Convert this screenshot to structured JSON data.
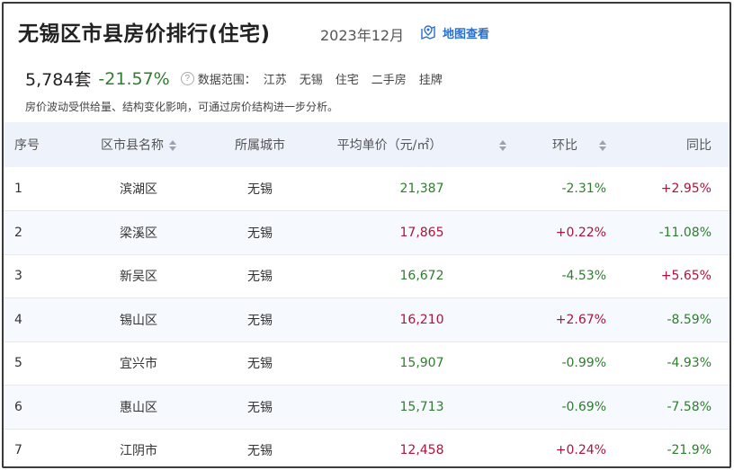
{
  "header": {
    "title": "无锡区市县房价排行(住宅)",
    "date": "2023年12月",
    "map_link": "地图查看",
    "count": "5,784套",
    "change": "-21.57%",
    "scope_label": "数据范围：",
    "scope": [
      "江苏",
      "无锡",
      "住宅",
      "二手房",
      "挂牌"
    ],
    "note": "房价波动受供给量、结构变化影响，可通过房价结构进一步分析。"
  },
  "table": {
    "columns": [
      "序号",
      "区市县名称",
      "所属城市",
      "平均单价（元/㎡）",
      "环比",
      "同比"
    ],
    "rows": [
      {
        "idx": "1",
        "district": "滨湖区",
        "city": "无锡",
        "price": "21,387",
        "price_trend": "down",
        "mom": "-2.31%",
        "yoy": "+2.95%"
      },
      {
        "idx": "2",
        "district": "梁溪区",
        "city": "无锡",
        "price": "17,865",
        "price_trend": "up",
        "mom": "+0.22%",
        "yoy": "-11.08%"
      },
      {
        "idx": "3",
        "district": "新吴区",
        "city": "无锡",
        "price": "16,672",
        "price_trend": "down",
        "mom": "-4.53%",
        "yoy": "+5.65%"
      },
      {
        "idx": "4",
        "district": "锡山区",
        "city": "无锡",
        "price": "16,210",
        "price_trend": "up",
        "mom": "+2.67%",
        "yoy": "-8.59%"
      },
      {
        "idx": "5",
        "district": "宜兴市",
        "city": "无锡",
        "price": "15,907",
        "price_trend": "down",
        "mom": "-0.99%",
        "yoy": "-4.93%"
      },
      {
        "idx": "6",
        "district": "惠山区",
        "city": "无锡",
        "price": "15,713",
        "price_trend": "down",
        "mom": "-0.69%",
        "yoy": "-7.58%"
      },
      {
        "idx": "7",
        "district": "江阴市",
        "city": "无锡",
        "price": "12,458",
        "price_trend": "up",
        "mom": "+0.24%",
        "yoy": "-21.9%"
      }
    ]
  },
  "colors": {
    "up": "#b0133c",
    "down": "#2f7d2f",
    "link": "#2a6fcb",
    "header_bg": "#eef3fb"
  }
}
